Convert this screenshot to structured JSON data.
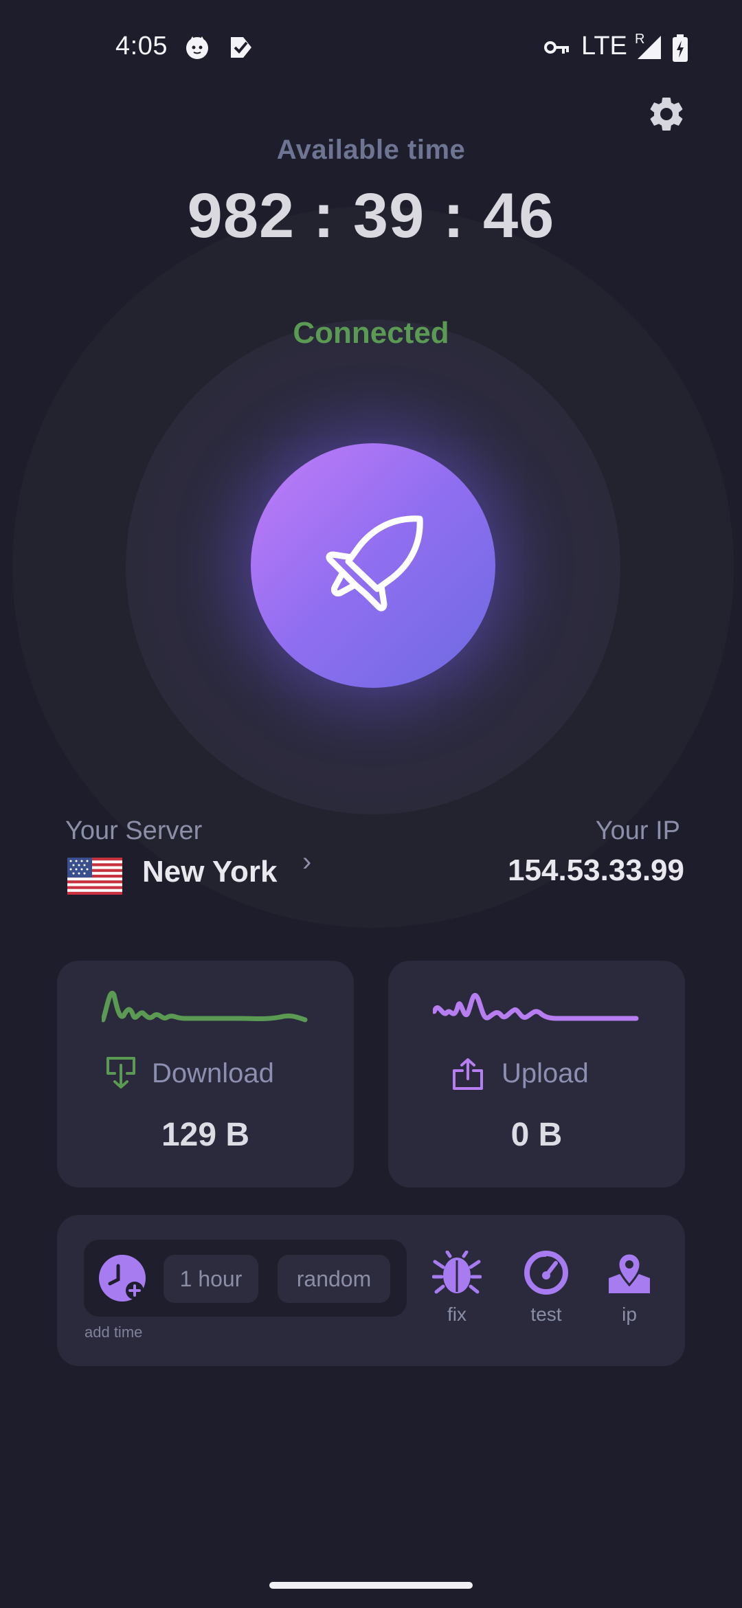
{
  "status_bar": {
    "time": "4:05",
    "network": "LTE",
    "roaming": "R",
    "icons": [
      "cat-notification-icon",
      "check-notification-icon",
      "vpn-key-icon",
      "signal-icon",
      "battery-charging-icon"
    ]
  },
  "header": {
    "available_label": "Available time",
    "timer": "982 : 39 : 46"
  },
  "connection": {
    "status": "Connected",
    "status_color": "#5a9a52",
    "button_icon": "rocket-icon"
  },
  "server": {
    "label": "Your Server",
    "name": "New York",
    "flag": "us-flag"
  },
  "ip": {
    "label": "Your IP",
    "value": "154.53.33.99"
  },
  "traffic": {
    "download": {
      "label": "Download",
      "value": "129 B",
      "color": "#5a9a52"
    },
    "upload": {
      "label": "Upload",
      "value": "0 B",
      "color": "#b77ef2"
    }
  },
  "tools": {
    "add_time_label": "add time",
    "chips": [
      "1 hour",
      "random"
    ],
    "items": [
      {
        "label": "fix",
        "icon": "bug-icon"
      },
      {
        "label": "test",
        "icon": "speedometer-icon"
      },
      {
        "label": "ip",
        "icon": "location-pin-icon"
      }
    ]
  },
  "colors": {
    "background": "#1e1d2b",
    "card": "#2b2a3c",
    "accent": "#a77cf0"
  }
}
